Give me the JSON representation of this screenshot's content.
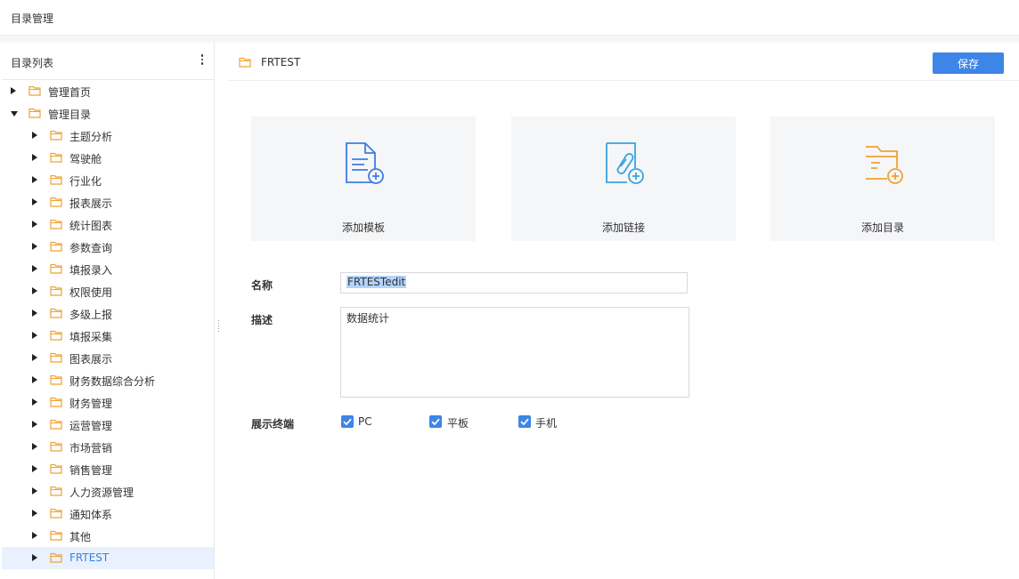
{
  "page": {
    "title": "目录管理"
  },
  "sidebar": {
    "header": "目录列表",
    "items": [
      {
        "label": "管理首页",
        "level": 0,
        "expanded": false,
        "selected": false
      },
      {
        "label": "管理目录",
        "level": 0,
        "expanded": true,
        "selected": false
      },
      {
        "label": "主题分析",
        "level": 1,
        "expanded": false,
        "selected": false
      },
      {
        "label": "驾驶舱",
        "level": 1,
        "expanded": false,
        "selected": false
      },
      {
        "label": "行业化",
        "level": 1,
        "expanded": false,
        "selected": false
      },
      {
        "label": "报表展示",
        "level": 1,
        "expanded": false,
        "selected": false
      },
      {
        "label": "统计图表",
        "level": 1,
        "expanded": false,
        "selected": false
      },
      {
        "label": "参数查询",
        "level": 1,
        "expanded": false,
        "selected": false
      },
      {
        "label": "填报录入",
        "level": 1,
        "expanded": false,
        "selected": false
      },
      {
        "label": "权限使用",
        "level": 1,
        "expanded": false,
        "selected": false
      },
      {
        "label": "多级上报",
        "level": 1,
        "expanded": false,
        "selected": false
      },
      {
        "label": "填报采集",
        "level": 1,
        "expanded": false,
        "selected": false
      },
      {
        "label": "图表展示",
        "level": 1,
        "expanded": false,
        "selected": false
      },
      {
        "label": "财务数据综合分析",
        "level": 1,
        "expanded": false,
        "selected": false
      },
      {
        "label": "财务管理",
        "level": 1,
        "expanded": false,
        "selected": false
      },
      {
        "label": "运营管理",
        "level": 1,
        "expanded": false,
        "selected": false
      },
      {
        "label": "市场营销",
        "level": 1,
        "expanded": false,
        "selected": false
      },
      {
        "label": "销售管理",
        "level": 1,
        "expanded": false,
        "selected": false
      },
      {
        "label": "人力资源管理",
        "level": 1,
        "expanded": false,
        "selected": false
      },
      {
        "label": "通知体系",
        "level": 1,
        "expanded": false,
        "selected": false
      },
      {
        "label": "其他",
        "level": 1,
        "expanded": false,
        "selected": false
      },
      {
        "label": "FRTEST",
        "level": 1,
        "expanded": false,
        "selected": true
      }
    ]
  },
  "main": {
    "title": "FRTEST",
    "save_label": "保存",
    "cards": [
      {
        "label": "添加模板",
        "icon": "add-template-icon",
        "color": "#3d7ee6"
      },
      {
        "label": "添加链接",
        "icon": "add-link-icon",
        "color": "#3aa3e0"
      },
      {
        "label": "添加目录",
        "icon": "add-folder-icon",
        "color": "#f0a232"
      }
    ],
    "form": {
      "name_label": "名称",
      "name_value": "FRTESTedit",
      "desc_label": "描述",
      "desc_value": "数据统计",
      "terminal_label": "展示终端",
      "terminals": [
        {
          "label": "PC",
          "checked": true
        },
        {
          "label": "平板",
          "checked": true
        },
        {
          "label": "手机",
          "checked": true
        }
      ]
    }
  },
  "colors": {
    "accent": "#3d85e6",
    "folder": "#f0a232",
    "selected_bg": "#e8f1fd"
  }
}
